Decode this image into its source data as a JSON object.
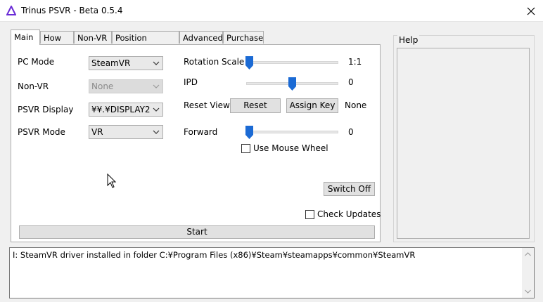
{
  "window": {
    "title": "Trinus PSVR - Beta 0.5.4"
  },
  "tabs": [
    {
      "label": "Main"
    },
    {
      "label": "How to"
    },
    {
      "label": "Non-VR"
    },
    {
      "label": "Position Tracker"
    },
    {
      "label": "Advanced"
    },
    {
      "label": "Purchase"
    }
  ],
  "left": {
    "pc_mode": {
      "label": "PC Mode",
      "value": "SteamVR"
    },
    "non_vr": {
      "label": "Non-VR",
      "value": "None"
    },
    "psvr_display": {
      "label": "PSVR Display",
      "value": "¥¥.¥DISPLAY2"
    },
    "psvr_mode": {
      "label": "PSVR Mode",
      "value": "VR"
    }
  },
  "right": {
    "rotation_scale": {
      "label": "Rotation Scale",
      "value": "1:1"
    },
    "ipd": {
      "label": "IPD",
      "value": "0"
    },
    "reset_view": {
      "label": "Reset View",
      "reset_label": "Reset",
      "assign_label": "Assign Key",
      "key_value": "None"
    },
    "forward": {
      "label": "Forward",
      "value": "0"
    },
    "use_mouse_wheel": {
      "label": "Use Mouse Wheel"
    }
  },
  "buttons": {
    "switch_off": "Switch Off",
    "start": "Start"
  },
  "check_updates": {
    "label": "Check Updates"
  },
  "help": {
    "title": "Help"
  },
  "log": {
    "line": "I: SteamVR driver installed in folder C:¥Program Files (x86)¥Steam¥steamapps¥common¥SteamVR"
  }
}
